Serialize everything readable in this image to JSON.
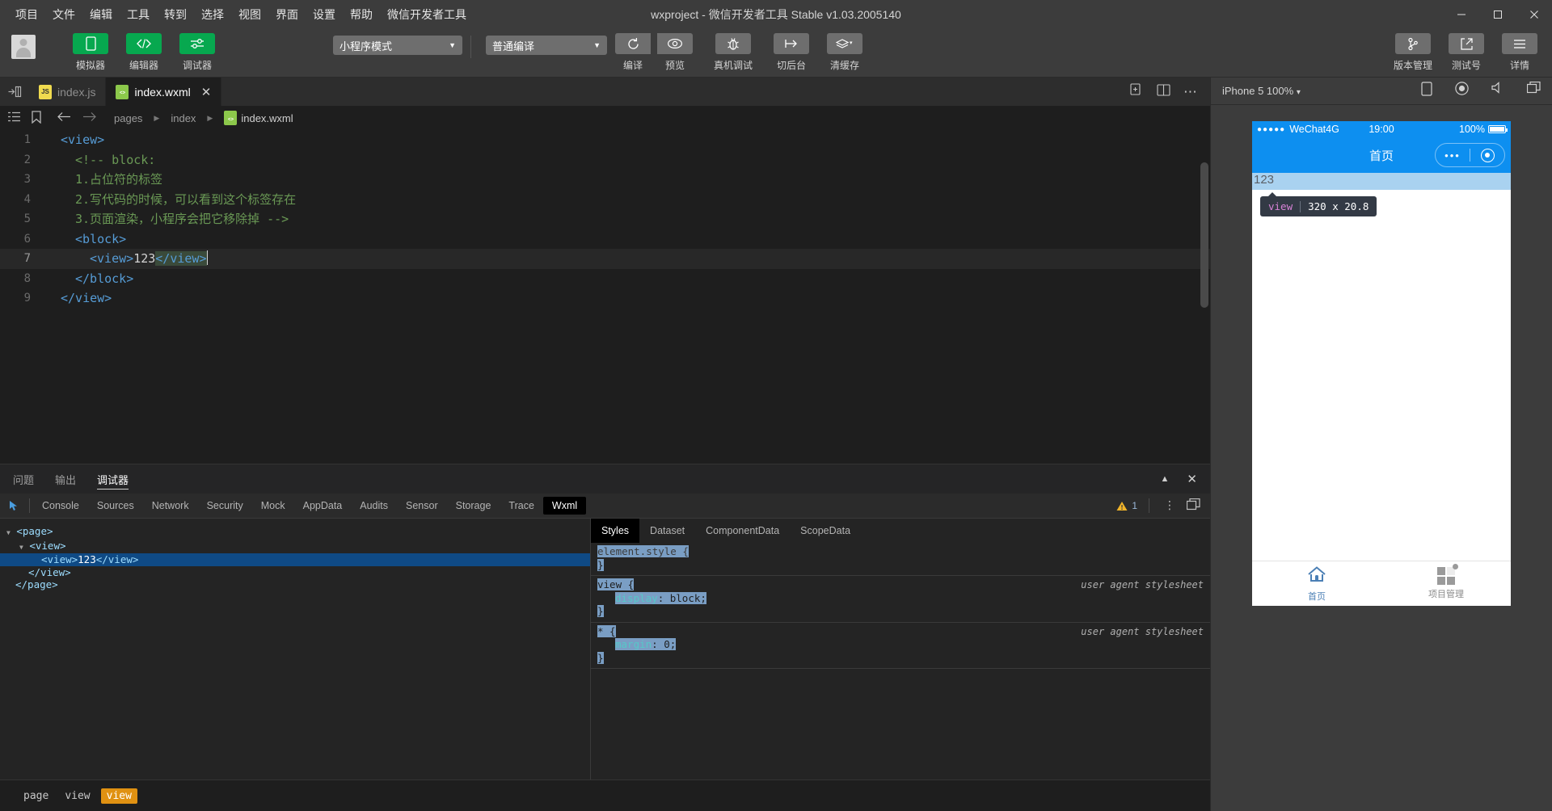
{
  "window": {
    "title": "wxproject - 微信开发者工具 Stable v1.03.2005140",
    "minimize": "–",
    "maximize": "☐",
    "close": "✕"
  },
  "menubar": {
    "items": [
      "项目",
      "文件",
      "编辑",
      "工具",
      "转到",
      "选择",
      "视图",
      "界面",
      "设置",
      "帮助",
      "微信开发者工具"
    ]
  },
  "toolbar": {
    "mode_buttons": [
      {
        "label": "模拟器",
        "icon": "phone-icon",
        "color": "#07a84f"
      },
      {
        "label": "编辑器",
        "icon": "code-icon",
        "color": "#07a84f"
      },
      {
        "label": "调试器",
        "icon": "sliders-icon",
        "color": "#07a84f"
      }
    ],
    "project_mode": "小程序模式",
    "compile_mode": "普通编译",
    "actions": [
      {
        "label": "编译",
        "icon": "refresh-icon"
      },
      {
        "label": "预览",
        "icon": "eye-icon"
      },
      {
        "label": "真机调试",
        "icon": "bug-icon"
      },
      {
        "label": "切后台",
        "icon": "background-icon"
      },
      {
        "label": "清缓存",
        "icon": "layers-icon"
      }
    ],
    "right_actions": [
      {
        "label": "版本管理",
        "icon": "git-branch-icon"
      },
      {
        "label": "测试号",
        "icon": "external-link-icon"
      },
      {
        "label": "详情",
        "icon": "menu-icon"
      }
    ]
  },
  "editor": {
    "tabs": [
      {
        "label": "index.js",
        "filetype": "JS",
        "active": false
      },
      {
        "label": "index.wxml",
        "filetype": "WXML",
        "active": true,
        "closable": true
      }
    ],
    "breadcrumb": [
      "pages",
      "index",
      "index.wxml"
    ],
    "lines": [
      {
        "n": "1",
        "indent": 0,
        "html": "<span class='tag'>&lt;view&gt;</span>"
      },
      {
        "n": "2",
        "indent": 1,
        "html": "<span class='comment'>&lt;!-- block:</span>"
      },
      {
        "n": "3",
        "indent": 1,
        "html": "<span class='comment'>1.占位符的标签</span>"
      },
      {
        "n": "4",
        "indent": 1,
        "html": "<span class='comment'>2.写代码的时候，可以看到这个标签存在</span>"
      },
      {
        "n": "5",
        "indent": 1,
        "html": "<span class='comment'>3.页面渲染，小程序会把它移除掉 --&gt;</span>"
      },
      {
        "n": "6",
        "indent": 1,
        "html": "<span class='tag'>&lt;block&gt;</span>"
      },
      {
        "n": "7",
        "indent": 2,
        "html": "<span class='tag'>&lt;view&gt;</span><span class='txt'>123</span><span class='selbg tag'>&lt;/view&gt;</span><span class='caret-bar'></span>",
        "highlight": true
      },
      {
        "n": "8",
        "indent": 1,
        "html": "<span class='tag'>&lt;/block&gt;</span>"
      },
      {
        "n": "9",
        "indent": 0,
        "html": "<span class='tag'>&lt;/view&gt;</span>"
      }
    ],
    "plain_text": "<view>\n  <!-- block:\n  1.占位符的标签\n  2.写代码的时候，可以看到这个标签存在\n  3.页面渲染，小程序会把它移除掉 -->\n  <block>\n    <view>123</view>\n  </block>\n</view>"
  },
  "debugger": {
    "panel_tabs": [
      {
        "label": "问题",
        "active": false
      },
      {
        "label": "输出",
        "active": false
      },
      {
        "label": "调试器",
        "active": true
      }
    ],
    "collapse_icon": "▲",
    "close_icon": "✕",
    "devtools_tabs": [
      {
        "label": "Console",
        "active": false
      },
      {
        "label": "Sources",
        "active": false
      },
      {
        "label": "Network",
        "active": false
      },
      {
        "label": "Security",
        "active": false
      },
      {
        "label": "Mock",
        "active": false
      },
      {
        "label": "AppData",
        "active": false
      },
      {
        "label": "Audits",
        "active": false
      },
      {
        "label": "Sensor",
        "active": false
      },
      {
        "label": "Storage",
        "active": false
      },
      {
        "label": "Trace",
        "active": false
      },
      {
        "label": "Wxml",
        "active": true
      }
    ],
    "warning_count": "1",
    "dom_tree": [
      {
        "indent": 0,
        "arrow": "▼",
        "html": "&lt;page&gt;",
        "selected": false
      },
      {
        "indent": 1,
        "arrow": "▼",
        "html": "&lt;view&gt;",
        "selected": false
      },
      {
        "indent": 2,
        "arrow": "",
        "html": "&lt;view&gt;<span class='dom-num'>123</span>&lt;/view&gt;",
        "selected": true
      },
      {
        "indent": 1,
        "arrow": "",
        "html": "&lt;/view&gt;",
        "selected": false
      },
      {
        "indent": 0,
        "arrow": "",
        "html": "&lt;/page&gt;",
        "selected": false
      }
    ],
    "styles_tabs": [
      {
        "label": "Styles",
        "active": true
      },
      {
        "label": "Dataset",
        "active": false
      },
      {
        "label": "ComponentData",
        "active": false
      },
      {
        "label": "ScopeData",
        "active": false
      }
    ],
    "style_rules": [
      {
        "selector": "element.style {",
        "close": "}",
        "declarations": [],
        "origin": "",
        "dim": true
      },
      {
        "selector": "view {",
        "close": "}",
        "declarations": [
          {
            "prop": "display",
            "value": "block;"
          }
        ],
        "origin": "user agent stylesheet",
        "dim": false
      },
      {
        "selector": "* {",
        "close": "}",
        "declarations": [
          {
            "prop": "margin",
            "value": "0;"
          }
        ],
        "origin": "user agent stylesheet",
        "dim": false
      }
    ],
    "bottom_crumbs": [
      {
        "label": "page",
        "active": false
      },
      {
        "label": "view",
        "active": false
      },
      {
        "label": "view",
        "active": true
      }
    ]
  },
  "simulator": {
    "device": "iPhone 5 100%",
    "device_caret": "▾",
    "header_icons": [
      "rotate-device-icon",
      "record-icon",
      "volume-icon",
      "detach-window-icon"
    ],
    "status_bar": {
      "signal_dots": "●●●●●",
      "carrier": "WeChat4G",
      "time": "19:00",
      "battery_percent": "100%"
    },
    "nav_title": "首页",
    "capsule": {
      "more": "•••",
      "target": "target-icon"
    },
    "page_content": "123",
    "tooltip": {
      "tag": "view",
      "size": "320 x 20.8"
    },
    "tabbar": [
      {
        "label": "首页",
        "icon": "home-icon",
        "active": true
      },
      {
        "label": "项目管理",
        "icon": "grid-icon",
        "active": false,
        "badge": true
      }
    ]
  },
  "colors": {
    "accent_green": "#07a84f",
    "wechat_blue": "#0d8ff0",
    "selection_blue": "#0f4a85",
    "crumb_orange": "#e09112"
  }
}
